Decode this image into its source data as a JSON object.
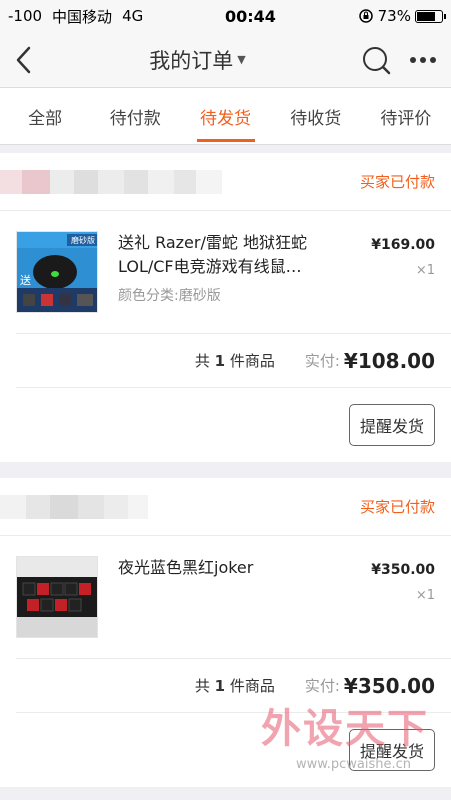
{
  "status_bar": {
    "signal": "-100",
    "carrier": "中国移动",
    "network": "4G",
    "time": "00:44",
    "battery_percent": "73%",
    "battery_level": 0.73
  },
  "nav": {
    "title": "我的订单"
  },
  "tabs": [
    {
      "label": "全部",
      "active": false
    },
    {
      "label": "待付款",
      "active": false
    },
    {
      "label": "待发货",
      "active": true
    },
    {
      "label": "待收货",
      "active": false
    },
    {
      "label": "待评价",
      "active": false
    }
  ],
  "orders": [
    {
      "status": "买家已付款",
      "item_title": "送礼 Razer/雷蛇 地狱狂蛇LOL/CF电竞游戏有线鼠…",
      "item_sku": "颜色分类:磨砂版",
      "item_price": "¥169.00",
      "item_qty": "×1",
      "count_prefix": "共",
      "count_num": "1",
      "count_suffix": "件商品",
      "paid_label": "实付:",
      "paid_value": "¥108.00",
      "action_label": "提醒发货",
      "thumb_text": "磨砂版",
      "thumb_text2": "送"
    },
    {
      "status": "买家已付款",
      "item_title": "夜光蓝色黑红joker",
      "item_sku": "",
      "item_price": "¥350.00",
      "item_qty": "×1",
      "count_prefix": "共",
      "count_num": "1",
      "count_suffix": "件商品",
      "paid_label": "实付:",
      "paid_value": "¥350.00",
      "action_label": "提醒发货"
    }
  ],
  "watermark": {
    "text": "外设天下",
    "url": "www.pcwaishe.cn"
  },
  "colors": {
    "accent": "#f25f1d",
    "background": "#efeff4"
  }
}
